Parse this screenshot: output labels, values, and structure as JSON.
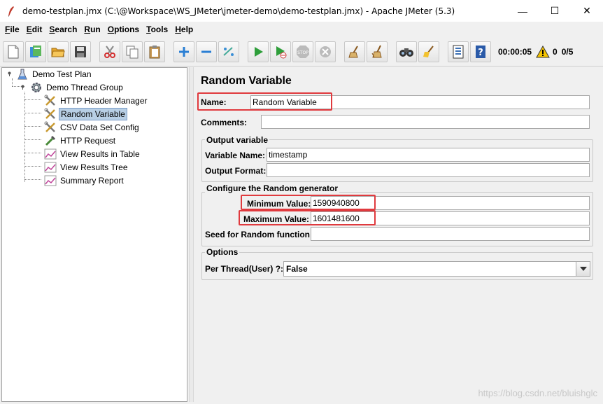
{
  "window": {
    "title": "demo-testplan.jmx (C:\\@Workspace\\WS_JMeter\\jmeter-demo\\demo-testplan.jmx) - Apache JMeter (5.3)",
    "minimize": "—",
    "maximize": "☐",
    "close": "✕"
  },
  "menu": {
    "items": [
      {
        "mnemonic": "F",
        "rest": "ile"
      },
      {
        "mnemonic": "E",
        "rest": "dit"
      },
      {
        "mnemonic": "S",
        "rest": "earch"
      },
      {
        "mnemonic": "R",
        "rest": "un"
      },
      {
        "mnemonic": "O",
        "rest": "ptions"
      },
      {
        "mnemonic": "T",
        "rest": "ools"
      },
      {
        "mnemonic": "H",
        "rest": "elp"
      }
    ]
  },
  "toolbar": {
    "elapsed_time": "00:00:05",
    "warnings_count": "0",
    "threads": "0/5",
    "buttons": [
      "new-icon",
      "templates-icon",
      "open-icon",
      "save-icon",
      "cut-icon",
      "copy-icon",
      "paste-icon",
      "expand-icon",
      "collapse-icon",
      "toggle-icon",
      "start-icon",
      "start-no-pause-icon",
      "stop-icon",
      "shutdown-icon",
      "clear-icon",
      "clear-all-icon",
      "search-icon",
      "reset-search-icon",
      "function-helper-icon",
      "help-icon"
    ]
  },
  "tree": {
    "root": "Demo Test  Plan",
    "thread_group": "Demo Thread Group",
    "children": [
      "HTTP Header Manager",
      "Random Variable",
      "CSV Data Set Config",
      "HTTP Request",
      "View Results in Table",
      "View Results Tree",
      "Summary Report"
    ],
    "selected": "Random Variable"
  },
  "panel": {
    "title": "Random Variable",
    "name_label": "Name:",
    "name_value": "Random Variable",
    "comments_label": "Comments:",
    "comments_value": "",
    "output_group": "Output variable",
    "variable_name_label": "Variable Name:",
    "variable_name_value": "timestamp",
    "output_format_label": "Output Format:",
    "output_format_value": "",
    "random_group": "Configure the Random generator",
    "minimum_label": "Minimum Value:",
    "minimum_value": "1590940800",
    "maximum_label": "Maximum Value:",
    "maximum_value": "1601481600",
    "seed_label": "Seed for Random function:",
    "seed_value": "",
    "options_group": "Options",
    "per_thread_label": "Per Thread(User) ?:",
    "per_thread_value": "False"
  },
  "watermark": "https://blog.csdn.net/bluishglc",
  "colors": {
    "highlight_box": "#e03a3e",
    "selection": "#b8cfe5"
  }
}
